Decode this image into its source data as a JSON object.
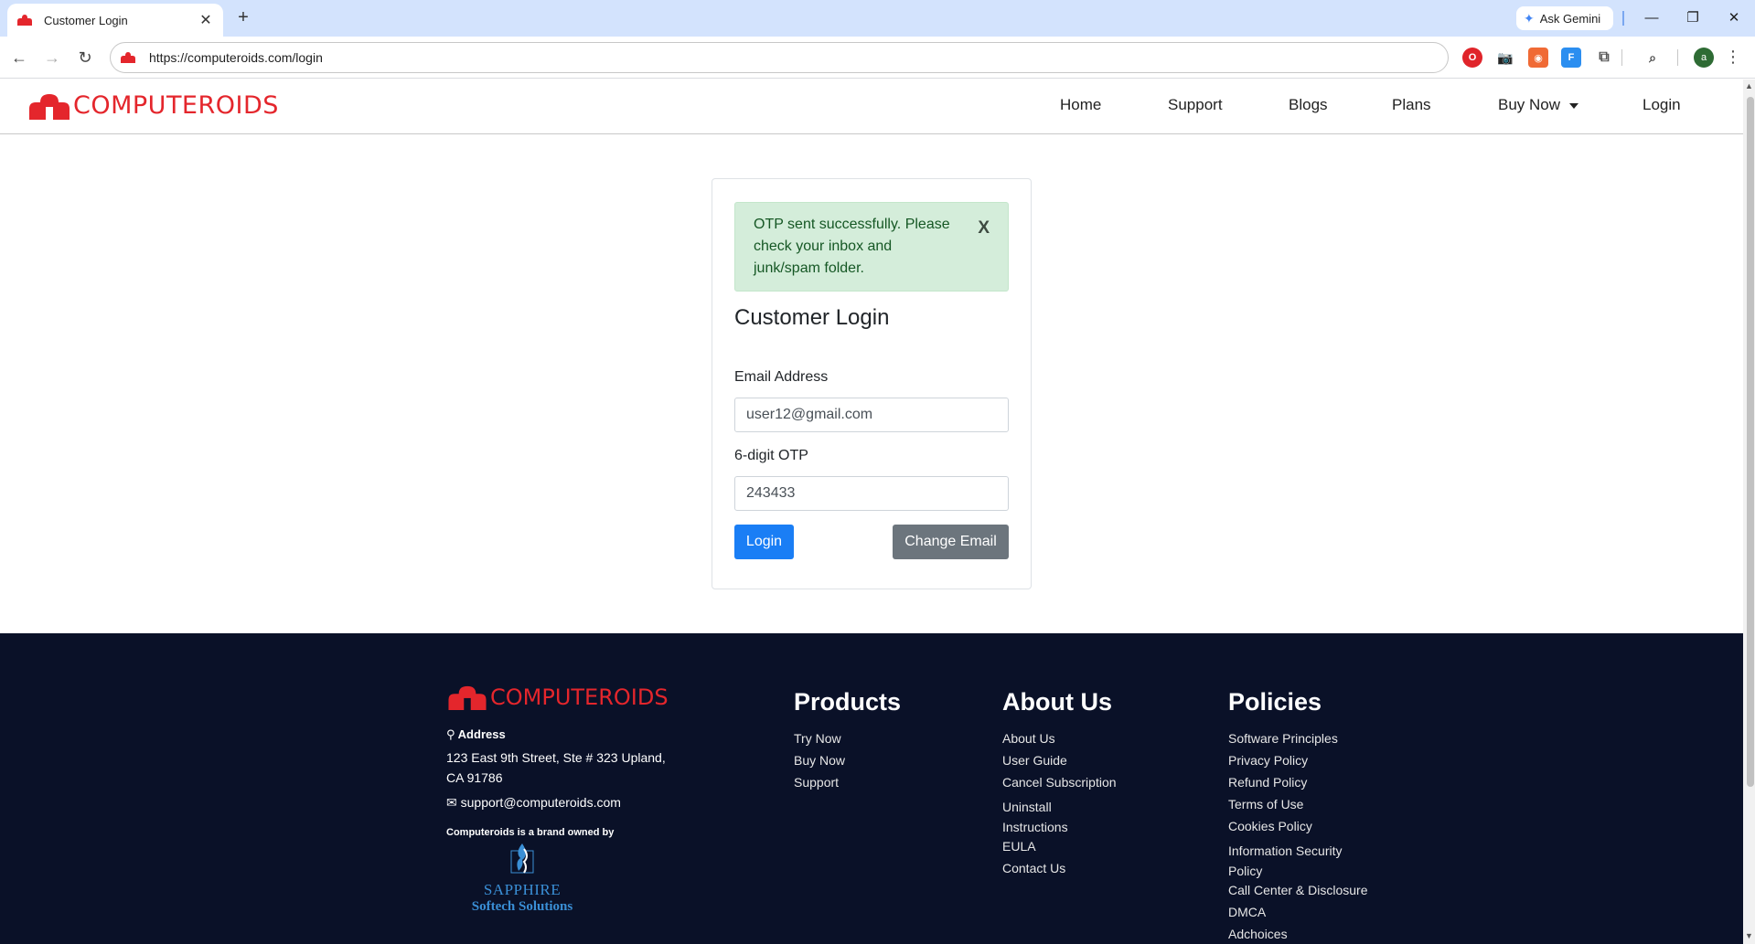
{
  "browser": {
    "tab_title": "Customer Login",
    "tab_close": "✕",
    "new_tab": "+",
    "gemini_label": "Ask Gemini",
    "url": "https://computeroids.com/login",
    "profile_initial": "a"
  },
  "header": {
    "logo_text": "COMPUTEROIDS",
    "nav": {
      "home": "Home",
      "support": "Support",
      "blogs": "Blogs",
      "plans": "Plans",
      "buy_now": "Buy Now",
      "login": "Login"
    }
  },
  "login_card": {
    "alert_text": "OTP sent successfully. Please check your inbox and junk/spam folder.",
    "alert_close": "X",
    "title": "Customer Login",
    "email_label": "Email Address",
    "email_value": "user12@gmail.com",
    "otp_label": "6-digit OTP",
    "otp_value": "243433",
    "login_button": "Login",
    "change_email_button": "Change Email"
  },
  "footer": {
    "logo_text": "COMPUTEROIDS",
    "address_heading": "Address",
    "address": "123 East 9th Street, Ste # 323 Upland, CA 91786",
    "email": "support@computeroids.com",
    "brand_note": "Computeroids is a brand owned by",
    "sapphire_line1": "SAPPHIRE",
    "sapphire_line2": "Softech Solutions",
    "products": {
      "heading": "Products",
      "links": [
        "Try Now",
        "Buy Now",
        "Support"
      ]
    },
    "about": {
      "heading": "About Us",
      "links": [
        "About Us",
        "User Guide",
        "Cancel Subscription",
        "Uninstall Instructions",
        "EULA",
        "Contact Us"
      ]
    },
    "policies": {
      "heading": "Policies",
      "links": [
        "Software Principles",
        "Privacy Policy",
        "Refund Policy",
        "Terms of Use",
        "Cookies Policy",
        "Information Security Policy",
        "Call Center & Disclosure",
        "DMCA",
        "Adchoices"
      ]
    }
  },
  "colors": {
    "brand_red": "#e4262c",
    "primary_button": "#1a7ef5",
    "secondary_button": "#6c757d",
    "alert_bg": "#d4edda",
    "footer_bg": "#0a1128"
  }
}
